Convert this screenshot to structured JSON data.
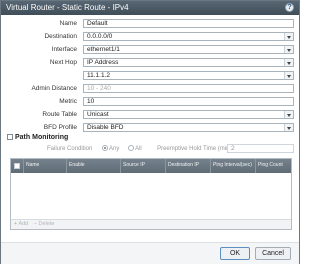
{
  "window": {
    "title": "Virtual Router - Static Route - IPv4",
    "help": "?"
  },
  "form": {
    "name": {
      "label": "Name",
      "value": "Default"
    },
    "destination": {
      "label": "Destination",
      "value": "0.0.0.0/0"
    },
    "interface": {
      "label": "Interface",
      "value": "ethernet1/1"
    },
    "next_hop": {
      "label": "Next Hop",
      "value": "IP Address",
      "address": "11.1.1.2"
    },
    "admin_distance": {
      "label": "Admin Distance",
      "placeholder": "10 - 240"
    },
    "metric": {
      "label": "Metric",
      "value": "10"
    },
    "route_table": {
      "label": "Route Table",
      "value": "Unicast"
    },
    "bfd_profile": {
      "label": "BFD Profile",
      "value": "Disable BFD"
    }
  },
  "path_monitoring": {
    "label": "Path Monitoring",
    "checked": false,
    "failure_condition_label": "Failure Condition",
    "option_any": "Any",
    "option_all": "All",
    "preemptive_label": "Preemptive Hold Time (min)",
    "preemptive_value": "2",
    "columns": [
      "Name",
      "Enable",
      "Source IP",
      "Destination IP",
      "Ping Interval(sec)",
      "Ping Count"
    ],
    "add_label": "Add",
    "delete_label": "Delete"
  },
  "buttons": {
    "ok": "OK",
    "cancel": "Cancel"
  },
  "colors": {
    "titlebar": "#4b5966",
    "ok_border": "#5c8fc0"
  }
}
